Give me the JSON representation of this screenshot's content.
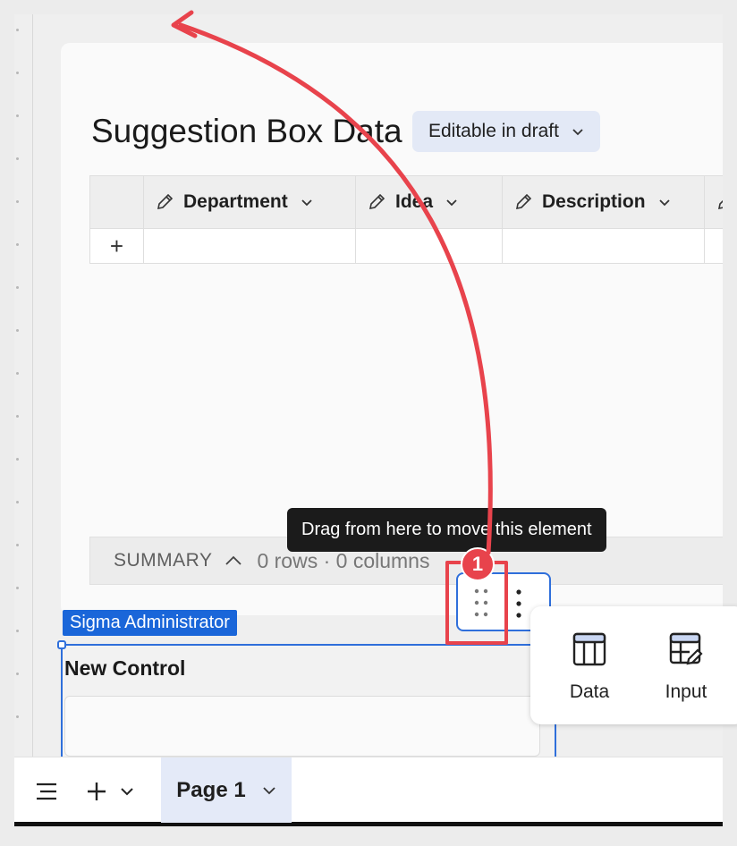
{
  "table": {
    "title": "Suggestion Box Data",
    "mode_pill": "Editable in draft",
    "columns": [
      {
        "label": "Department"
      },
      {
        "label": "Idea"
      },
      {
        "label": "Description"
      }
    ],
    "add_row_symbol": "+"
  },
  "summary": {
    "label": "SUMMARY",
    "counts": "0 rows · 0 columns"
  },
  "tooltip": {
    "text": "Drag from here to move this element"
  },
  "annotation": {
    "step_number": "1",
    "color": "#e8434c"
  },
  "insert_panel": {
    "items": [
      {
        "label": "Data",
        "icon": "table-icon"
      },
      {
        "label": "Input",
        "icon": "input-table-icon"
      }
    ]
  },
  "user_tag": "Sigma Administrator",
  "control": {
    "title": "New Control"
  },
  "bottom_bar": {
    "page_tab": "Page 1"
  },
  "colors": {
    "accent": "#2f6fdb",
    "user_tag": "#1a66d9",
    "pill_bg": "#e3e9f6"
  }
}
